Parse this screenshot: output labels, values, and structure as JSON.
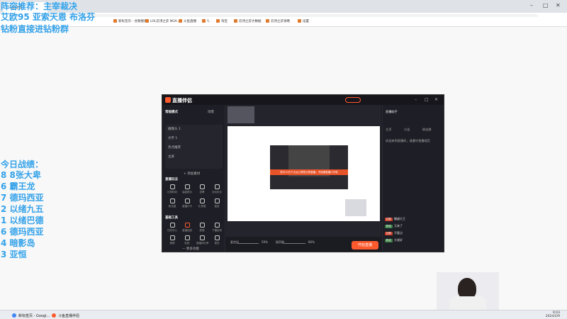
{
  "overlay": {
    "line1": "阵容推荐：主宰裁决",
    "line2": "艾欧95  亚索天恩  布洛芬",
    "line3": "钻粉直接进钻粉群",
    "stats_title": "今日战绩：",
    "stats": [
      "8 8张大卑",
      "6 霸王龙",
      "7 德玛西亚",
      "2 以绪九五",
      "1 以绪巴德",
      "6 德玛西亚",
      "4 暗影岛",
      "3 亚恒"
    ]
  },
  "browser": {
    "bookmarks": [
      "新标签页 - 谷歌搜索",
      "LOL云顶之弈 NGA...",
      "斗鱼直播",
      "Y...",
      "淘宝",
      "云顶之弈大数据",
      "云顶之弈攻略",
      "设置"
    ],
    "tab": "斗鱼直播"
  },
  "app": {
    "title": "直播伴侣",
    "scene_label": "常规模式",
    "scene_tab": "场景",
    "sources": [
      "摄像头 1",
      "文字 1",
      "热点推荐",
      "主屏"
    ],
    "add_source": "+ 添加素材",
    "tools_title": "直播玩法",
    "tools": [
      "礼物特效",
      "高能提示",
      "投票",
      "互动玩法",
      "粉丝团",
      "直播口令",
      "礼物墙",
      "抽奖"
    ],
    "more_title": "基础工具",
    "more_tools": [
      "任务中心",
      "直播回放",
      "数据",
      "下播检测",
      "美颜",
      "贴纸",
      "直播间分享",
      "更多"
    ],
    "more_link": "— 更多功能",
    "notice": "您与10万个大伙儿帮您计算直播，不能漏直播口令啦",
    "start_button": "开始直播",
    "mic_label": "麦克风",
    "speaker_label": "扬声器",
    "mic_value": "59%",
    "speaker_value": "80%",
    "right_title": "直播助手",
    "right_tabs": [
      "主页",
      "公告",
      "粉丝群"
    ],
    "right_hint": "欢迎来到直播间，请遵守直播规范",
    "chats": [
      {
        "tag": "钻粉",
        "name": "翻越大王",
        "green": false
      },
      {
        "tag": "粉丝",
        "name": "又来了",
        "green": true
      },
      {
        "tag": "钻粉",
        "name": "不要点",
        "green": false
      },
      {
        "tag": "粉丝",
        "name": "大佬好",
        "green": true
      }
    ]
  },
  "taskbar": {
    "items": [
      "新标签页 - Googl...",
      "斗鱼直播伴侣"
    ],
    "time": "9:03",
    "date": "2024/2/9"
  }
}
